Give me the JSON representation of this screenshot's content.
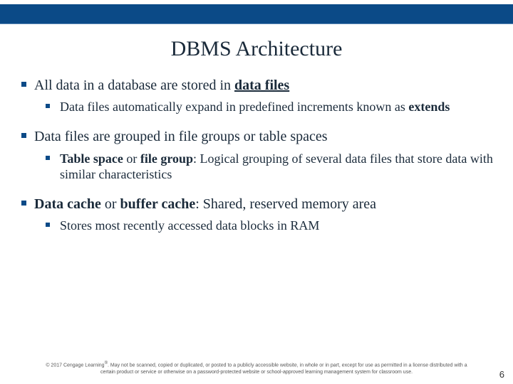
{
  "title": "DBMS Architecture",
  "bullets": {
    "b1_pre": "All data in a database are stored in ",
    "b1_bold": "data files",
    "b1_1_pre": "Data files automatically expand in predefined increments known as ",
    "b1_1_bold": "extends",
    "b2": "Data files are grouped in file groups or table spaces",
    "b2_1_bold1": "Table space",
    "b2_1_mid1": " or ",
    "b2_1_bold2": "file group",
    "b2_1_post": ": Logical grouping of several data files that store data with similar characteristics",
    "b3_bold1": "Data cache",
    "b3_mid": " or ",
    "b3_bold2": "buffer cache",
    "b3_post": ": Shared, reserved memory area",
    "b3_1": "Stores most recently accessed data blocks in RAM"
  },
  "footer": {
    "line1a": "© 2017 Cengage Learning",
    "line1b": ". May not be scanned, copied or duplicated, or posted to a publicly accessible website, in whole or in part, except for use as permitted in a license distributed with a",
    "line2": "certain product or service or otherwise on a password-protected website or school-approved learning management system for classroom use."
  },
  "page_number": "6"
}
